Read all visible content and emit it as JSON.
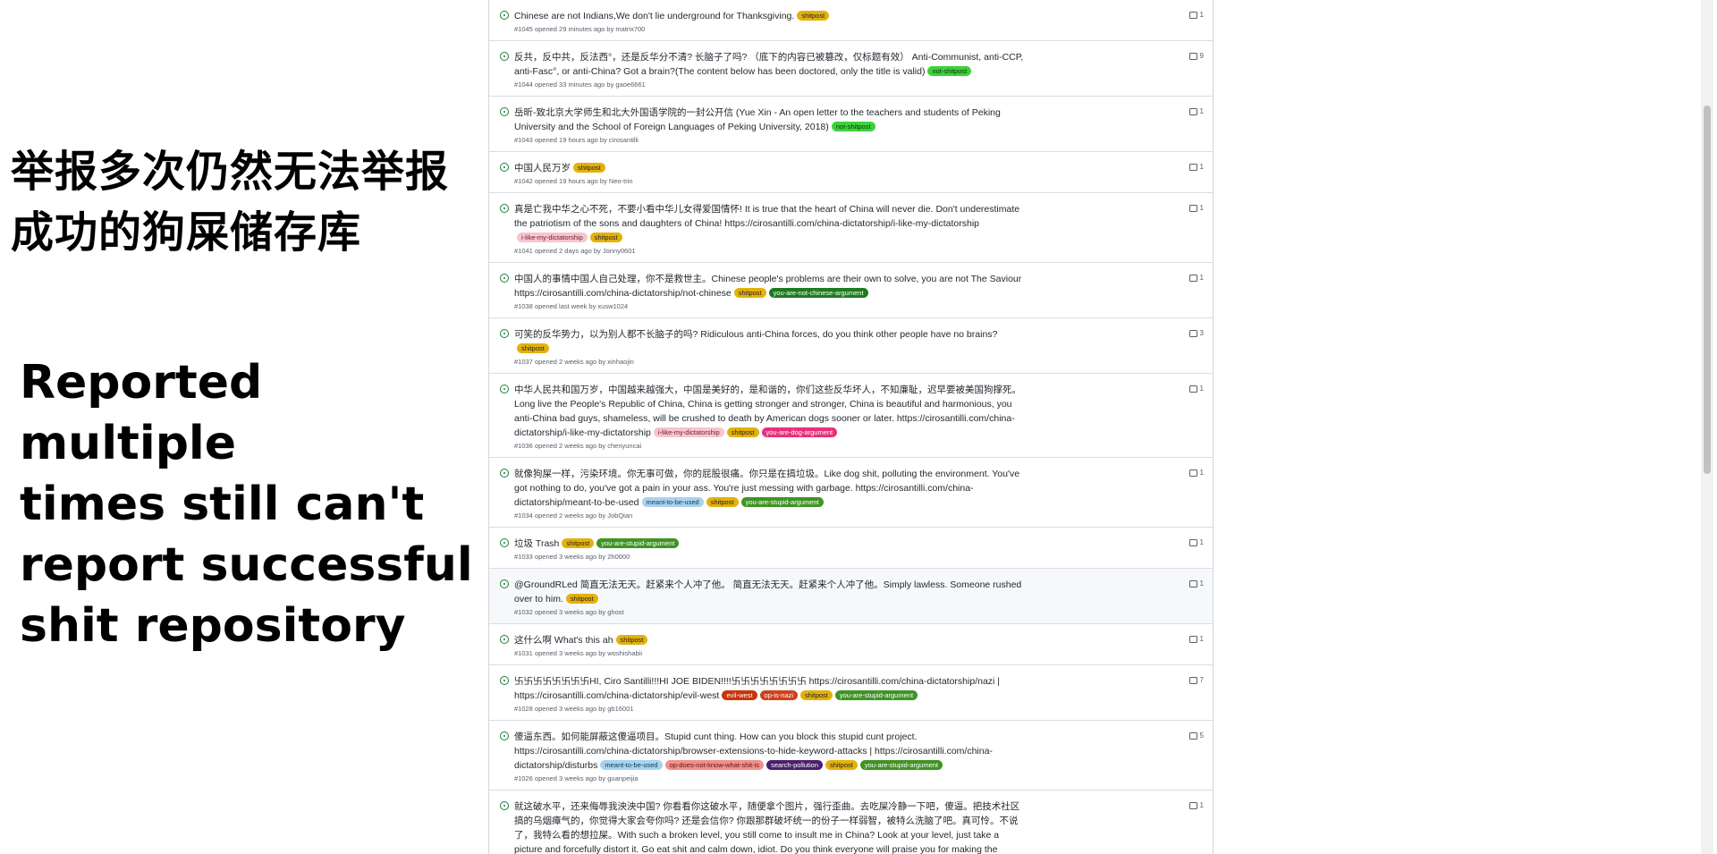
{
  "caption": {
    "chinese": "举报多次仍然无法举报成功的狗屎储存库",
    "english": "Reported multiple\n times still can't\nreport successful\n shit repository"
  },
  "labels": {
    "shitpost": {
      "bg": "#e4b10c",
      "fg": "#1f1f1f"
    },
    "not-shitpost": {
      "bg": "#3dd23b",
      "fg": "#0c2f0c"
    },
    "i-like-my-dictatorship": {
      "bg": "#f7c4cf",
      "fg": "#6b1e2c"
    },
    "you-are-not-chinese-argument": {
      "bg": "#1e7a20",
      "fg": "#ffffff"
    },
    "you-are-dog-argument": {
      "bg": "#e8317c",
      "fg": "#ffffff"
    },
    "meant-to-be-used": {
      "bg": "#a9d2ee",
      "fg": "#0f3b5a"
    },
    "you-are-stupid-argument": {
      "bg": "#3f9425",
      "fg": "#ffffff"
    },
    "evil-west": {
      "bg": "#c7360a",
      "fg": "#ffffff"
    },
    "op-is-nazi": {
      "bg": "#d1401b",
      "fg": "#ffffff"
    },
    "op-does-not-know-what-shit-is": {
      "bg": "#f1908a",
      "fg": "#5a1410"
    },
    "search-pollution": {
      "bg": "#4a1f6e",
      "fg": "#ffffff"
    }
  },
  "issues": [
    {
      "title": "Chinese are not Indians,We don't lie underground for Thanksgiving.",
      "labels": [
        "shitpost"
      ],
      "meta": "#1045 opened 29 minutes ago by matrix700",
      "comments": "1"
    },
    {
      "title": "反共，反中共，反法西°，还是反华分不清? 长脑子了吗? （底下的内容已被篡改，仅标题有效） Anti-Communist, anti-CCP, anti-Fasc°, or anti-China? Got a brain?(The content below has been doctored, only the title is valid)",
      "labels": [
        "not-shitpost"
      ],
      "meta": "#1044 opened 33 minutes ago by gaoe6661",
      "comments": "9"
    },
    {
      "title": "岳昕-致北京大学师生和北大外国语学院的一封公开信 (Yue Xin - An open letter to the teachers and students of Peking University and the School of Foreign Languages of Peking University, 2018)",
      "labels": [
        "not-shitpost"
      ],
      "meta": "#1043 opened 19 hours ago by cirosantilli",
      "comments": "1"
    },
    {
      "title": "中国人民万岁",
      "labels": [
        "shitpost"
      ],
      "meta": "#1042 opened 19 hours ago by Neo-trin",
      "comments": "1"
    },
    {
      "title": "真是亡我中华之心不死，不要小看中华儿女得爱国情怀! It is true that the heart of China will never die. Don't underestimate the patriotism of the sons and daughters of China! https://cirosantilli.com/china-dictatorship/i-like-my-dictatorship",
      "labels": [
        "i-like-my-dictatorship",
        "shitpost"
      ],
      "meta": "#1041 opened 2 days ago by Jonny0601",
      "comments": "1"
    },
    {
      "title": "中国人的事情中国人自己处理，你不是救世主。Chinese people's problems are their own to solve, you are not The Saviour https://cirosantilli.com/china-dictatorship/not-chinese",
      "labels": [
        "shitpost",
        "you-are-not-chinese-argument"
      ],
      "meta": "#1038 opened last week by xusw1024",
      "comments": "1"
    },
    {
      "title": "可笑的反华势力，以为别人都不长脑子的吗? Ridiculous anti-China forces, do you think other people have no brains?",
      "labels": [
        "shitpost"
      ],
      "meta": "#1037 opened 2 weeks ago by xinhaojin",
      "comments": "3"
    },
    {
      "title": "中华人民共和国万岁，中国越来越强大，中国是美好的，是和谐的，你们这些反华坏人，不知廉耻，迟早要被美国狗撑死。Long live the People's Republic of China, China is getting stronger and stronger, China is beautiful and harmonious, you anti-China bad guys, shameless, will be crushed to death by American dogs sooner or later. https://cirosantilli.com/china-dictatorship/i-like-my-dictatorship",
      "labels": [
        "i-like-my-dictatorship",
        "shitpost",
        "you-are-dog-argument"
      ],
      "meta": "#1036 opened 2 weeks ago by chenyuncai",
      "comments": "1"
    },
    {
      "title": "就像狗屎一样，污染环境。你无事可做，你的屁股很痛。你只是在搞垃圾。Like dog shit, polluting the environment. You've got nothing to do, you've got a pain in your ass. You're just messing with garbage. https://cirosantilli.com/china-dictatorship/meant-to-be-used",
      "labels": [
        "meant-to-be-used",
        "shitpost",
        "you-are-stupid-argument"
      ],
      "meta": "#1034 opened 2 weeks ago by JobQian",
      "comments": "1"
    },
    {
      "title": "垃圾 Trash",
      "labels": [
        "shitpost",
        "you-are-stupid-argument"
      ],
      "meta": "#1033 opened 3 weeks ago by 2h0000",
      "comments": "1"
    },
    {
      "title": "@GroundRLed 简直无法无天。赶紧来个人冲了他。 简直无法无天。赶紧来个人冲了他。Simply lawless. Someone rushed over to him.",
      "labels": [
        "shitpost"
      ],
      "meta": "#1032 opened 3 weeks ago by ghost",
      "comments": "1",
      "highlight": true
    },
    {
      "title": "这什么啊 What's this ah",
      "labels": [
        "shitpost"
      ],
      "meta": "#1031 opened 3 weeks ago by woshishabii",
      "comments": "1"
    },
    {
      "title": "卐卐卐卐卐卐卐卐HI, Ciro Santilli!!!HI JOE BIDEN!!!!卐卐卐卐卐卐卐卐 https://cirosantilli.com/china-dictatorship/nazi | https://cirosantilli.com/china-dictatorship/evil-west",
      "labels": [
        "evil-west",
        "op-is-nazi",
        "shitpost",
        "you-are-stupid-argument"
      ],
      "meta": "#1028 opened 3 weeks ago by gb16001",
      "comments": "7"
    },
    {
      "title": "傻逼东西。如何能屏蔽这傻逼项目。Stupid cunt thing. How can you block this stupid cunt project. https://cirosantilli.com/china-dictatorship/browser-extensions-to-hide-keyword-attacks | https://cirosantilli.com/china-dictatorship/disturbs",
      "labels": [
        "meant-to-be-used",
        "op-does-not-know-what-shit-is",
        "search-pollution",
        "shitpost",
        "you-are-stupid-argument"
      ],
      "meta": "#1026 opened 3 weeks ago by guanpeijia",
      "comments": "5"
    },
    {
      "title": "就这破水平，还来侮辱我泱泱中国? 你看看你这破水平，随便拿个图片，强行歪曲。去吃屎冷静一下吧，傻逼。把技术社区搞的乌烟瘴气的，你觉得大家会夸你吗? 还是会信你? 你跟那群破坏统一的份子一样弱智，被特么洗脑了吧。真可怜。不说了，我特么看的想拉屎。With such a broken level, you still come to insult me in China? Look at your level, just take a picture and forcefully distort it. Go eat shit and calm down, idiot. Do you think everyone will praise you for making the technical community a mess? Still believe you? You are as mentally retarded as the group of people who disrupted",
      "labels": [],
      "meta": "",
      "comments": "1"
    }
  ]
}
